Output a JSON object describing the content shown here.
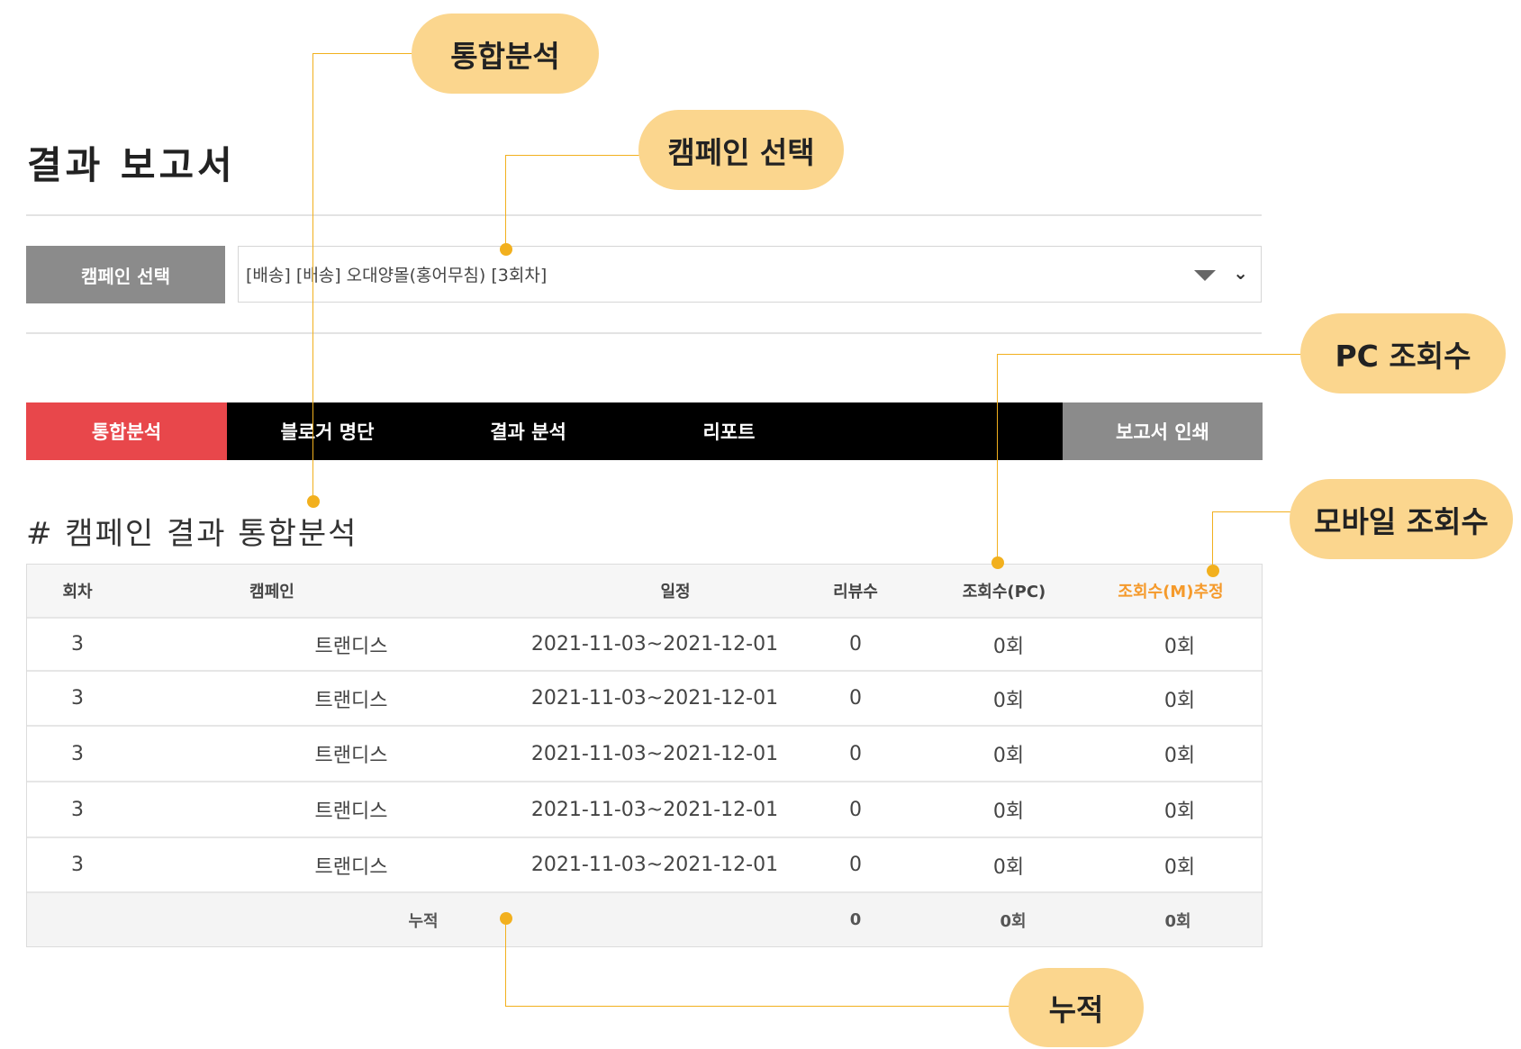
{
  "page": {
    "title": "결과 보고서"
  },
  "campaign_select": {
    "label": "캠페인 선택",
    "value": "[배송] [배송] 오대양몰(홍어무침) [3회차]"
  },
  "tabs": [
    {
      "label": "통합분석",
      "active": true
    },
    {
      "label": "블로거 명단",
      "active": false
    },
    {
      "label": "결과 분석",
      "active": false
    },
    {
      "label": "리포트",
      "active": false
    }
  ],
  "print_button": "보고서 인쇄",
  "section_title": "# 캠페인 결과 통합분석",
  "table": {
    "headers": [
      "회차",
      "캠페인",
      "일정",
      "리뷰수",
      "조회수(PC)",
      "조회수(M)추정"
    ],
    "rows": [
      [
        "3",
        "트랜디스",
        "2021-11-03~2021-12-01",
        "0",
        "0회",
        "0회"
      ],
      [
        "3",
        "트랜디스",
        "2021-11-03~2021-12-01",
        "0",
        "0회",
        "0회"
      ],
      [
        "3",
        "트랜디스",
        "2021-11-03~2021-12-01",
        "0",
        "0회",
        "0회"
      ],
      [
        "3",
        "트랜디스",
        "2021-11-03~2021-12-01",
        "0",
        "0회",
        "0회"
      ],
      [
        "3",
        "트랜디스",
        "2021-11-03~2021-12-01",
        "0",
        "0회",
        "0회"
      ]
    ],
    "total": {
      "label": "누적",
      "reviews": "0",
      "pc_views": "0회",
      "mobile_views": "0회"
    }
  },
  "callouts": {
    "integrated": "통합분석",
    "campaign_select": "캠페인 선택",
    "pc_views": "PC 조회수",
    "mobile_views": "모바일 조회수",
    "cumulative": "누적"
  },
  "colors": {
    "active_tab": "#e8474b",
    "tab_bar": "#000000",
    "gray_button": "#8b8b8b",
    "callout_fill": "#fbd68e",
    "callout_line": "#f2b01e",
    "mobile_header": "#f59a2b"
  }
}
